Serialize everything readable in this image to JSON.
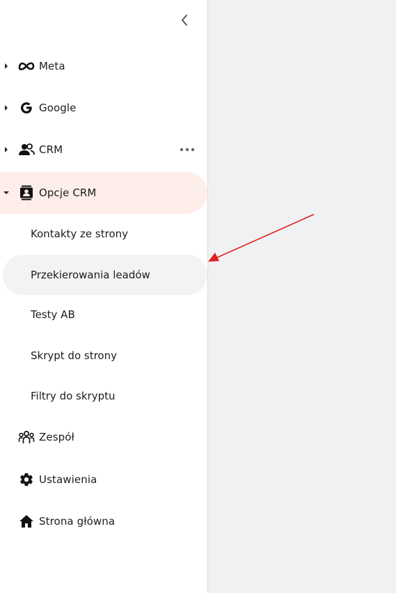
{
  "sidebar": {
    "collapse_icon": "chevron-left-icon",
    "items": [
      {
        "label": "Meta",
        "icon": "meta-icon"
      },
      {
        "label": "Google",
        "icon": "google-icon"
      },
      {
        "label": "CRM",
        "icon": "users-icon"
      },
      {
        "label": "Opcje CRM",
        "icon": "contact-card-icon"
      }
    ],
    "subitems": [
      {
        "label": "Kontakty ze strony"
      },
      {
        "label": "Przekierowania leadów"
      },
      {
        "label": "Testy AB"
      },
      {
        "label": "Skrypt do strony"
      },
      {
        "label": "Filtry do skryptu"
      }
    ],
    "bottom_items": [
      {
        "label": "Zespół",
        "icon": "team-icon"
      },
      {
        "label": "Ustawienia",
        "icon": "gear-icon"
      },
      {
        "label": "Strona główna",
        "icon": "home-icon"
      }
    ]
  },
  "colors": {
    "active_bg": "#fdeeea",
    "highlight_bg": "#f3f3f3",
    "annotation_arrow": "#e02020",
    "content_bg": "#f0f1f3"
  }
}
